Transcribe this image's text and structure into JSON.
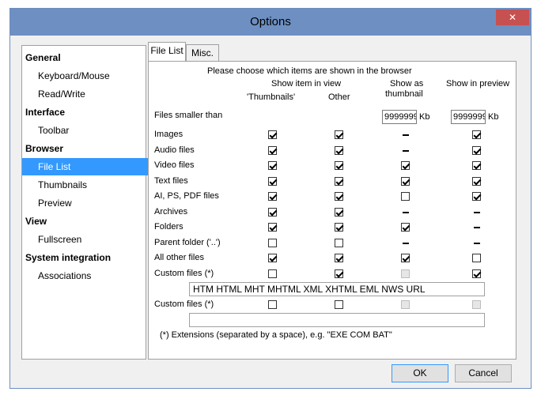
{
  "window": {
    "title": "Options",
    "close_glyph": "✕"
  },
  "nav": {
    "items": [
      {
        "label": "General",
        "kind": "section"
      },
      {
        "label": "Keyboard/Mouse",
        "kind": "child"
      },
      {
        "label": "Read/Write",
        "kind": "child"
      },
      {
        "label": "Interface",
        "kind": "section"
      },
      {
        "label": "Toolbar",
        "kind": "child"
      },
      {
        "label": "Browser",
        "kind": "section"
      },
      {
        "label": "File List",
        "kind": "child",
        "selected": true
      },
      {
        "label": "Thumbnails",
        "kind": "child"
      },
      {
        "label": "Preview",
        "kind": "child"
      },
      {
        "label": "View",
        "kind": "section"
      },
      {
        "label": "Fullscreen",
        "kind": "child"
      },
      {
        "label": "System integration",
        "kind": "section"
      },
      {
        "label": "Associations",
        "kind": "child"
      }
    ]
  },
  "tabs": [
    {
      "label": "File List",
      "active": true
    },
    {
      "label": "Misc.",
      "active": false
    }
  ],
  "panel": {
    "intro": "Please choose which items are shown in the browser",
    "group_header": "Show item in view",
    "col_thumbnails": "'Thumbnails'",
    "col_other": "Other",
    "col_thumb_line1": "Show as",
    "col_thumb_line2": "thumbnail",
    "col_preview": "Show in preview",
    "files_smaller_label": "Files smaller than",
    "thumb_size_value": "9999999",
    "preview_size_value": "9999999",
    "unit": "Kb",
    "rows": [
      {
        "label": "Images",
        "cells": [
          "checked",
          "checked",
          "dash",
          "checked"
        ]
      },
      {
        "label": "Audio files",
        "cells": [
          "checked",
          "checked",
          "dash",
          "checked"
        ]
      },
      {
        "label": "Video files",
        "cells": [
          "checked",
          "checked",
          "checked",
          "checked"
        ]
      },
      {
        "label": "Text files",
        "cells": [
          "checked",
          "checked",
          "checked",
          "checked"
        ]
      },
      {
        "label": "AI, PS, PDF files",
        "cells": [
          "checked",
          "checked",
          "unchecked",
          "checked"
        ]
      },
      {
        "label": "Archives",
        "cells": [
          "checked",
          "checked",
          "dash",
          "dash"
        ]
      },
      {
        "label": "Folders",
        "cells": [
          "checked",
          "checked",
          "checked",
          "dash"
        ]
      },
      {
        "label": "Parent folder ('..')",
        "cells": [
          "unchecked",
          "unchecked",
          "dash",
          "dash"
        ]
      },
      {
        "label": "All other files",
        "cells": [
          "checked",
          "checked",
          "checked",
          "unchecked"
        ]
      },
      {
        "label": "Custom files (*)",
        "cells": [
          "unchecked",
          "checked",
          "disabled",
          "checked"
        ]
      },
      {
        "label": "Custom files (*)",
        "cells": [
          "unchecked",
          "unchecked",
          "disabled",
          "disabled"
        ]
      }
    ],
    "custom1_extensions": "HTM HTML MHT MHTML XML XHTML EML NWS URL",
    "custom2_extensions": "",
    "footnote": "(*) Extensions (separated by a space), e.g. \"EXE COM BAT\""
  },
  "buttons": {
    "ok": "OK",
    "cancel": "Cancel"
  }
}
